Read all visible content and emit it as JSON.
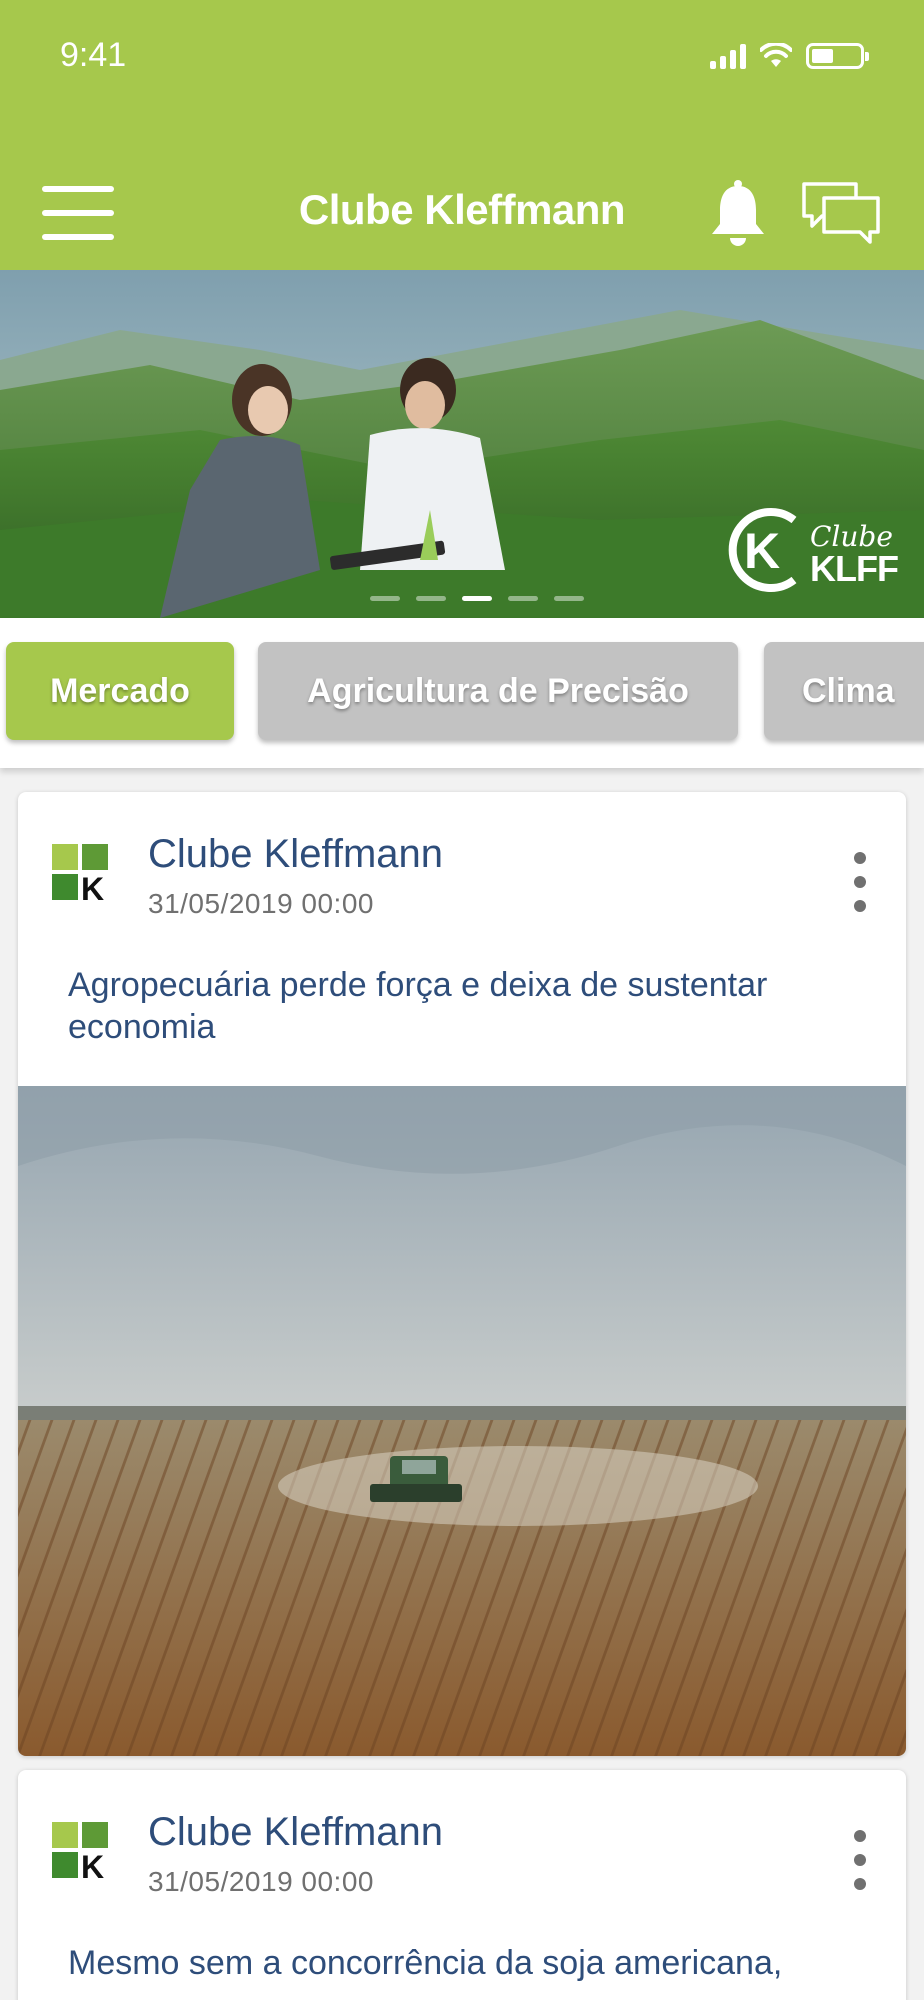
{
  "status_bar": {
    "time": "9:41",
    "battery_level": 0.45
  },
  "header": {
    "title": "Clube Kleffmann",
    "menu_icon": "hamburger-icon",
    "notification_icon": "bell-icon",
    "chat_icon": "chat-bubbles-icon"
  },
  "banner": {
    "logo_clube": "Clube",
    "logo_klff": "KLFF",
    "slide_count": 5,
    "active_slide": 3
  },
  "tabs": [
    {
      "label": "Mercado",
      "active": true
    },
    {
      "label": "Agricultura de Precisão",
      "active": false
    },
    {
      "label": "Clima",
      "active": false
    }
  ],
  "feed": [
    {
      "author": "Clube Kleffmann",
      "date": "31/05/2019 00:00",
      "headline": "Agropecuária perde força e deixa de sustentar economia",
      "image": "harvest-field-image"
    },
    {
      "author": "Clube Kleffmann",
      "date": "31/05/2019 00:00",
      "headline": "Mesmo sem a concorrência da soja americana,"
    }
  ],
  "colors": {
    "brand_green": "#a6c84c",
    "tab_inactive": "#c2c2c2",
    "text_blue": "#2e4d7a",
    "text_gray": "#707070"
  }
}
